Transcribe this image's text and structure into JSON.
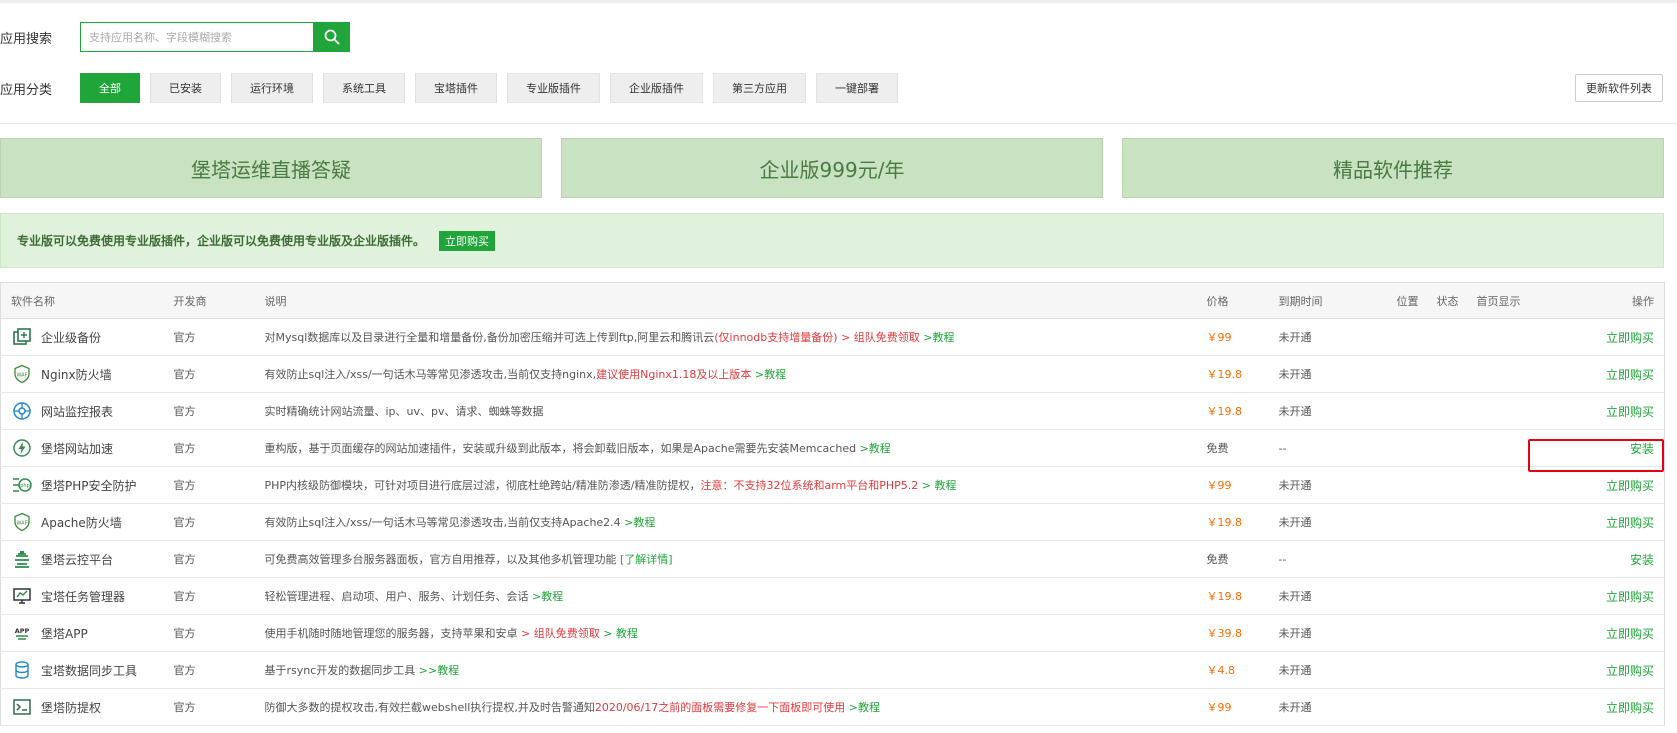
{
  "search": {
    "label": "应用搜索",
    "placeholder": "支持应用名称、字段模糊搜索"
  },
  "categories": {
    "label": "应用分类",
    "items": [
      "全部",
      "已安装",
      "运行环境",
      "系统工具",
      "宝塔插件",
      "专业版插件",
      "企业版插件",
      "第三方应用",
      "一键部署"
    ],
    "refresh_label": "更新软件列表"
  },
  "banners": [
    "堡塔运维直播答疑",
    "企业版999元/年",
    "精品软件推荐"
  ],
  "notice": {
    "text": "专业版可以免费使用专业版插件，企业版可以免费使用专业版及企业版插件。",
    "button": "立即购买"
  },
  "table": {
    "headers": [
      "软件名称",
      "开发商",
      "说明",
      "价格",
      "到期时间",
      "位置",
      "状态",
      "首页显示",
      "操作"
    ],
    "rows": [
      {
        "name": "企业级备份",
        "vendor": "官方",
        "desc": "对Mysql数据库以及目录进行全量和增量备份,备份加密压缩并可选上传到ftp,阿里云和腾讯云",
        "desc_red": "(仅innodb支持增量备份) > 组队免费领取",
        "desc_green": " >教程",
        "price": "￥99",
        "expire": "未开通",
        "action": "立即购买",
        "icon": "backup-icon"
      },
      {
        "name": "Nginx防火墙",
        "vendor": "官方",
        "desc": "有效防止sql注入/xss/一句话木马等常见渗透攻击,当前仅支持nginx,",
        "desc_red": "建议使用Nginx1.18及以上版本",
        "desc_green": " >教程",
        "price": "￥19.8",
        "expire": "未开通",
        "action": "立即购买",
        "icon": "waf-icon"
      },
      {
        "name": "网站监控报表",
        "vendor": "官方",
        "desc": "实时精确统计网站流量、ip、uv、pv、请求、蜘蛛等数据",
        "desc_red": "",
        "desc_green": "",
        "price": "￥19.8",
        "expire": "未开通",
        "action": "立即购买",
        "icon": "monitor-icon"
      },
      {
        "name": "堡塔网站加速",
        "vendor": "官方",
        "desc": "重构版，基于页面缓存的网站加速插件，安装或升级到此版本，将会卸载旧版本，如果是Apache需要先安装Memcached",
        "desc_red": "",
        "desc_green": " >教程",
        "price": "免费",
        "expire": "--",
        "action": "安装",
        "icon": "lightning-icon"
      },
      {
        "name": "堡塔PHP安全防护",
        "vendor": "官方",
        "desc": "PHP内核级防御模块，可针对项目进行底层过滤，彻底杜绝跨站/精准防渗透/精准防提权，",
        "desc_red": "注意：不支持32位系统和arm平台和PHP5.2",
        "desc_green": " > 教程",
        "price": "￥99",
        "expire": "未开通",
        "action": "立即购买",
        "icon": "php-shield-icon"
      },
      {
        "name": "Apache防火墙",
        "vendor": "官方",
        "desc": "有效防止sql注入/xss/一句话木马等常见渗透攻击,当前仅支持Apache2.4",
        "desc_red": "",
        "desc_green": " >教程",
        "price": "￥19.8",
        "expire": "未开通",
        "action": "立即购买",
        "icon": "waf-icon"
      },
      {
        "name": "堡塔云控平台",
        "vendor": "官方",
        "desc": "可免费高效管理多台服务器面板，官方自用推荐，以及其他多机管理功能",
        "desc_red": "",
        "desc_green": " [了解详情]",
        "price": "免费",
        "expire": "--",
        "action": "安装",
        "icon": "cloud-platform-icon"
      },
      {
        "name": "宝塔任务管理器",
        "vendor": "官方",
        "desc": "轻松管理进程、启动项、用户、服务、计划任务、会话",
        "desc_red": "",
        "desc_green": " >教程",
        "price": "￥19.8",
        "expire": "未开通",
        "action": "立即购买",
        "icon": "task-manager-icon"
      },
      {
        "name": "堡塔APP",
        "vendor": "官方",
        "desc": "使用手机随时随地管理您的服务器，支持苹果和安卓",
        "desc_red": " > 组队免费领取",
        "desc_green": " > 教程",
        "price": "￥39.8",
        "expire": "未开通",
        "action": "立即购买",
        "icon": "app-icon"
      },
      {
        "name": "宝塔数据同步工具",
        "vendor": "官方",
        "desc": "基于rsync开发的数据同步工具",
        "desc_red": "",
        "desc_green": " >>教程",
        "price": "￥4.8",
        "expire": "未开通",
        "action": "立即购买",
        "icon": "database-sync-icon"
      },
      {
        "name": "堡塔防提权",
        "vendor": "官方",
        "desc": "防御大多数的提权攻击,有效拦截webshell执行提权,并及时告警通知",
        "desc_red": "2020/06/17之前的面板需要修复一下面板即可使用",
        "desc_green": " >教程",
        "price": "￥99",
        "expire": "未开通",
        "action": "立即购买",
        "icon": "terminal-icon"
      }
    ]
  },
  "colors": {
    "brand": "#20a53a",
    "price": "#ff6a00",
    "warn": "#e4393c",
    "highlight": "#e60012"
  }
}
